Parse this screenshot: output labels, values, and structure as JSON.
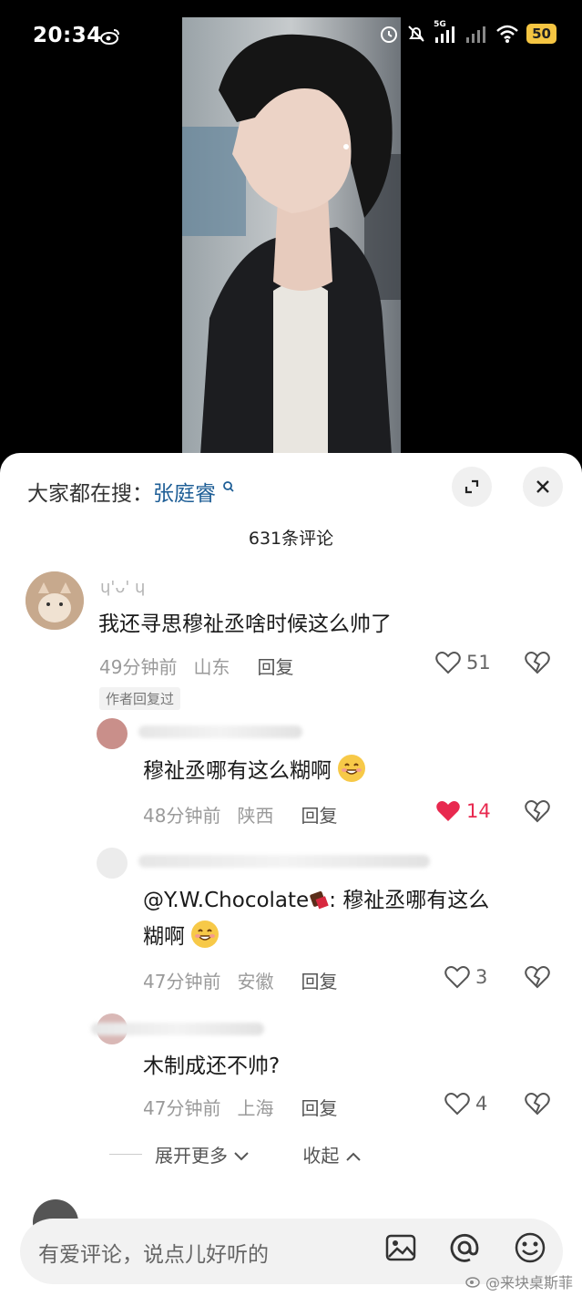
{
  "status": {
    "time": "20:34",
    "network": "5G",
    "battery": "50"
  },
  "search": {
    "prefix": "大家都在搜：",
    "keyword": "张庭睿"
  },
  "comments_count": "631条评论",
  "comments": [
    {
      "username": "ɥ'ᴗ' ɥ",
      "text": "我还寻思穆祉丞啥时候这么帅了",
      "time": "49分钟前",
      "location": "山东",
      "reply": "回复",
      "likes": "51",
      "badge": "作者回复过"
    }
  ],
  "replies": [
    {
      "text": "穆祉丞哪有这么糊啊",
      "time": "48分钟前",
      "location": "陕西",
      "reply": "回复",
      "likes": "14",
      "liked": true
    },
    {
      "mention": "@Y.W.Chocolate",
      "text_after": ": 穆祉丞哪有这么",
      "text_line2": "糊啊",
      "time": "47分钟前",
      "location": "安徽",
      "reply": "回复",
      "likes": "3"
    },
    {
      "text": "木制成还不帅?",
      "time": "47分钟前",
      "location": "上海",
      "reply": "回复",
      "likes": "4"
    }
  ],
  "thread_controls": {
    "expand": "展开更多",
    "collapse": "收起"
  },
  "input": {
    "placeholder": "有爱评论，说点儿好听的"
  },
  "watermark": "@来块桌斯菲",
  "colors": {
    "accent_link": "#1e5e96",
    "like_red": "#e8294f",
    "battery": "#f5c542"
  }
}
